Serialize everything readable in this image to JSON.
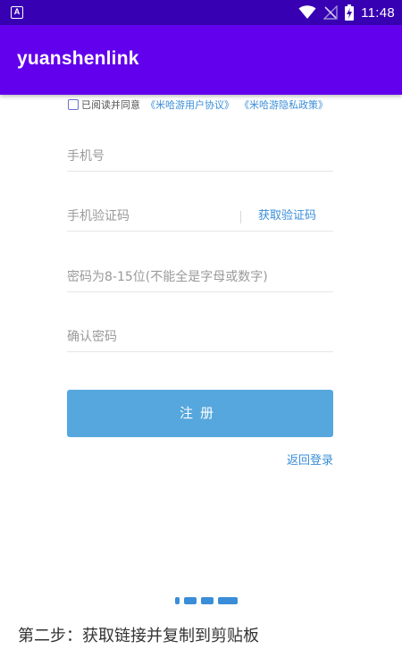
{
  "status_bar": {
    "app_icon_letter": "A",
    "time": "11:48",
    "icons": [
      "app-notification-icon",
      "wifi-icon",
      "no-signal-icon",
      "battery-charging-icon"
    ]
  },
  "app_bar": {
    "title": "yuanshenlink"
  },
  "form": {
    "agree_text": "已阅读并同意",
    "agreement_link_1": "《米哈游用户协议》",
    "agreement_link_2": "《米哈游隐私政策》",
    "phone_placeholder": "手机号",
    "code_placeholder": "手机验证码",
    "get_code_label": "获取验证码",
    "password_placeholder": "密码为8-15位(不能全是字母或数字)",
    "confirm_password_placeholder": "确认密码",
    "register_label": "注册",
    "back_to_login_label": "返回登录"
  },
  "caption": "第二步：获取链接并复制到剪贴板",
  "colors": {
    "status_bar_bg": "#3700b3",
    "app_bar_bg": "#6200ee",
    "register_button_bg": "#55a7dd",
    "link_color": "#3a8ed8"
  }
}
